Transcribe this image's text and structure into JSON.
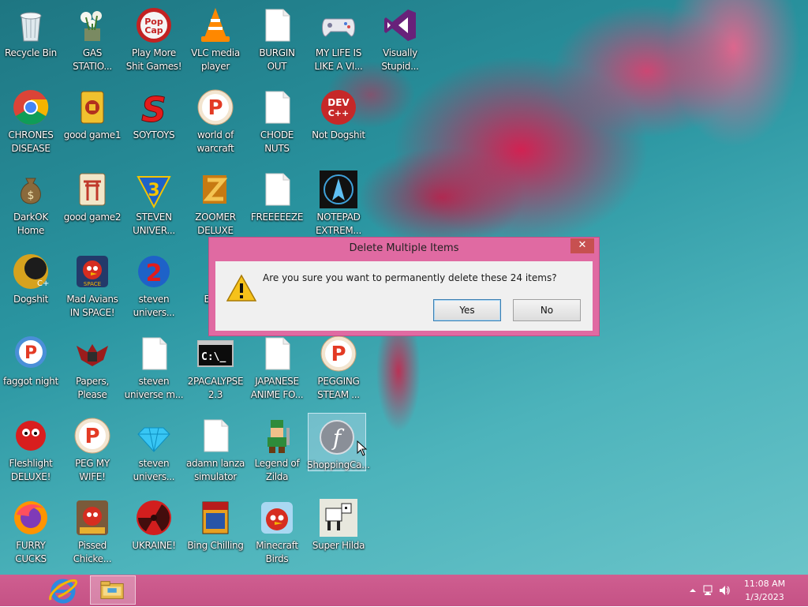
{
  "desktop": {
    "icons": [
      {
        "label": "Recycle Bin",
        "icon": "recycle-bin-icon"
      },
      {
        "label": "GAS\nSTATIO...",
        "icon": "plant-icon"
      },
      {
        "label": "Play More\nShit Games!",
        "icon": "popcap-icon"
      },
      {
        "label": "VLC media\nplayer",
        "icon": "vlc-cone-icon"
      },
      {
        "label": "BURGIN\nOUT",
        "icon": "blank-file-icon"
      },
      {
        "label": "MY LIFE IS\nLIKE A VI...",
        "icon": "gamepad-icon"
      },
      {
        "label": "Visually\nStupid...",
        "icon": "visual-studio-icon"
      },
      {
        "label": "CHRONES\nDISEASE",
        "icon": "chrome-icon"
      },
      {
        "label": "good game1",
        "icon": "mahjong-tile-icon"
      },
      {
        "label": "SOYTOYS",
        "icon": "red-s-icon"
      },
      {
        "label": "world of\nwarcraft",
        "icon": "p-badge-icon"
      },
      {
        "label": "CHODE\nNUTS",
        "icon": "blank-file-icon"
      },
      {
        "label": "Not Dogshit",
        "icon": "dev-cpp-icon"
      },
      {
        "label": "DarkOK\nHome",
        "icon": "money-bag-icon"
      },
      {
        "label": "good game2",
        "icon": "mahjong-gate-icon"
      },
      {
        "label": "STEVEN\nUNIVER...",
        "icon": "number-3-icon"
      },
      {
        "label": "ZOOMER\nDELUXE",
        "icon": "zoomer-icon"
      },
      {
        "label": "FREEEEEZE",
        "icon": "blank-file-icon"
      },
      {
        "label": "NOTEPAD\nEXTREM...",
        "icon": "notepad-extreme-icon"
      },
      {
        "label": "Dogshit",
        "icon": "dev-cpp-gold-icon"
      },
      {
        "label": "Mad Avians\nIN SPACE!",
        "icon": "angry-bird-space-icon"
      },
      {
        "label": "steven\nunivers...",
        "icon": "number-2-icon"
      },
      {
        "label": "Ende",
        "icon": "diamond-icon"
      },
      {
        "label": "faggot night",
        "icon": "p-bubble-icon"
      },
      {
        "label": "Papers,\nPlease",
        "icon": "eagle-emblem-icon"
      },
      {
        "label": "steven\nuniverse m...",
        "icon": "blank-file-icon"
      },
      {
        "label": "2PACALYPSE\n2.3",
        "icon": "console-icon"
      },
      {
        "label": "JAPANESE\nANIME FO...",
        "icon": "blank-file-icon"
      },
      {
        "label": "PEGGING\nSTEAM ...",
        "icon": "p-badge-icon"
      },
      {
        "label": "Fleshlight\nDELUXE!",
        "icon": "red-creature-icon"
      },
      {
        "label": "PEG MY\nWIFE!",
        "icon": "p-badge-icon"
      },
      {
        "label": "steven\nunivers...",
        "icon": "gem-icon"
      },
      {
        "label": "adamn lanza\nsimulator",
        "icon": "blank-file-icon"
      },
      {
        "label": "Legend of\nZilda",
        "icon": "pixel-hero-icon"
      },
      {
        "label": "ShoppingCa...",
        "icon": "flash-icon"
      },
      {
        "label": "FURRY\nCUCKS",
        "icon": "firefox-icon"
      },
      {
        "label": "Pissed\nChicke...",
        "icon": "angry-bird-seasons-icon"
      },
      {
        "label": "UKRAINE!",
        "icon": "radiation-icon"
      },
      {
        "label": "Bing Chilling",
        "icon": "box-art-icon"
      },
      {
        "label": "Minecraft\nBirds",
        "icon": "angry-bird-icon"
      },
      {
        "label": "Super Hilda",
        "icon": "pixel-dog-icon"
      }
    ]
  },
  "dialog": {
    "title": "Delete Multiple Items",
    "message": "Are you sure you want to permanently delete these 24 items?",
    "yes_label": "Yes",
    "no_label": "No",
    "close_glyph": "✕"
  },
  "taskbar": {
    "apps": [
      {
        "name": "Internet Explorer",
        "icon": "ie-icon"
      },
      {
        "name": "File Explorer",
        "icon": "folder-icon"
      }
    ],
    "time": "11:08 AM",
    "date": "1/3/2023"
  },
  "colors": {
    "taskbar": "#c85689",
    "dialog_frame": "#e06aa2",
    "desktop_bg": "#2a95a1",
    "flower": "#da1c4e"
  }
}
